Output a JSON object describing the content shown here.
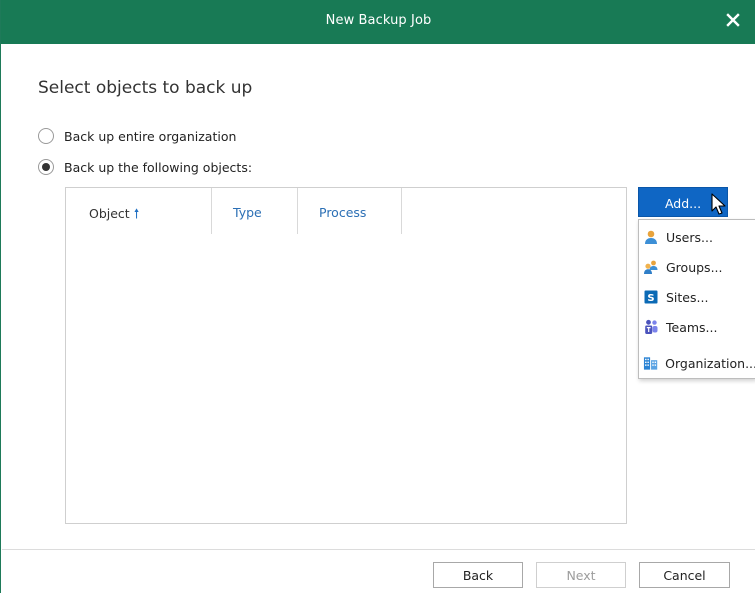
{
  "window": {
    "title": "New Backup Job"
  },
  "page": {
    "heading": "Select objects to back up"
  },
  "options": [
    {
      "label": "Back up entire organization",
      "checked": false
    },
    {
      "label": "Back up the following objects:",
      "checked": true
    }
  ],
  "table": {
    "columns": [
      {
        "label": "Object",
        "sort": "ascending"
      },
      {
        "label": "Type"
      },
      {
        "label": "Process"
      }
    ],
    "rows": []
  },
  "add_button": {
    "label": "Add..."
  },
  "add_menu": {
    "items": [
      {
        "label": "Users...",
        "icon": "user-icon"
      },
      {
        "label": "Groups...",
        "icon": "group-icon"
      },
      {
        "label": "Sites...",
        "icon": "sharepoint-icon"
      },
      {
        "label": "Teams...",
        "icon": "teams-icon"
      },
      {
        "label": "Organization...",
        "icon": "organization-icon"
      }
    ]
  },
  "footer": {
    "back_label": "Back",
    "next_label": "Next",
    "cancel_label": "Cancel"
  },
  "colors": {
    "title_bar": "#187a55",
    "add_button": "#0f66c4",
    "column_header_text": "#2b6fb5"
  }
}
